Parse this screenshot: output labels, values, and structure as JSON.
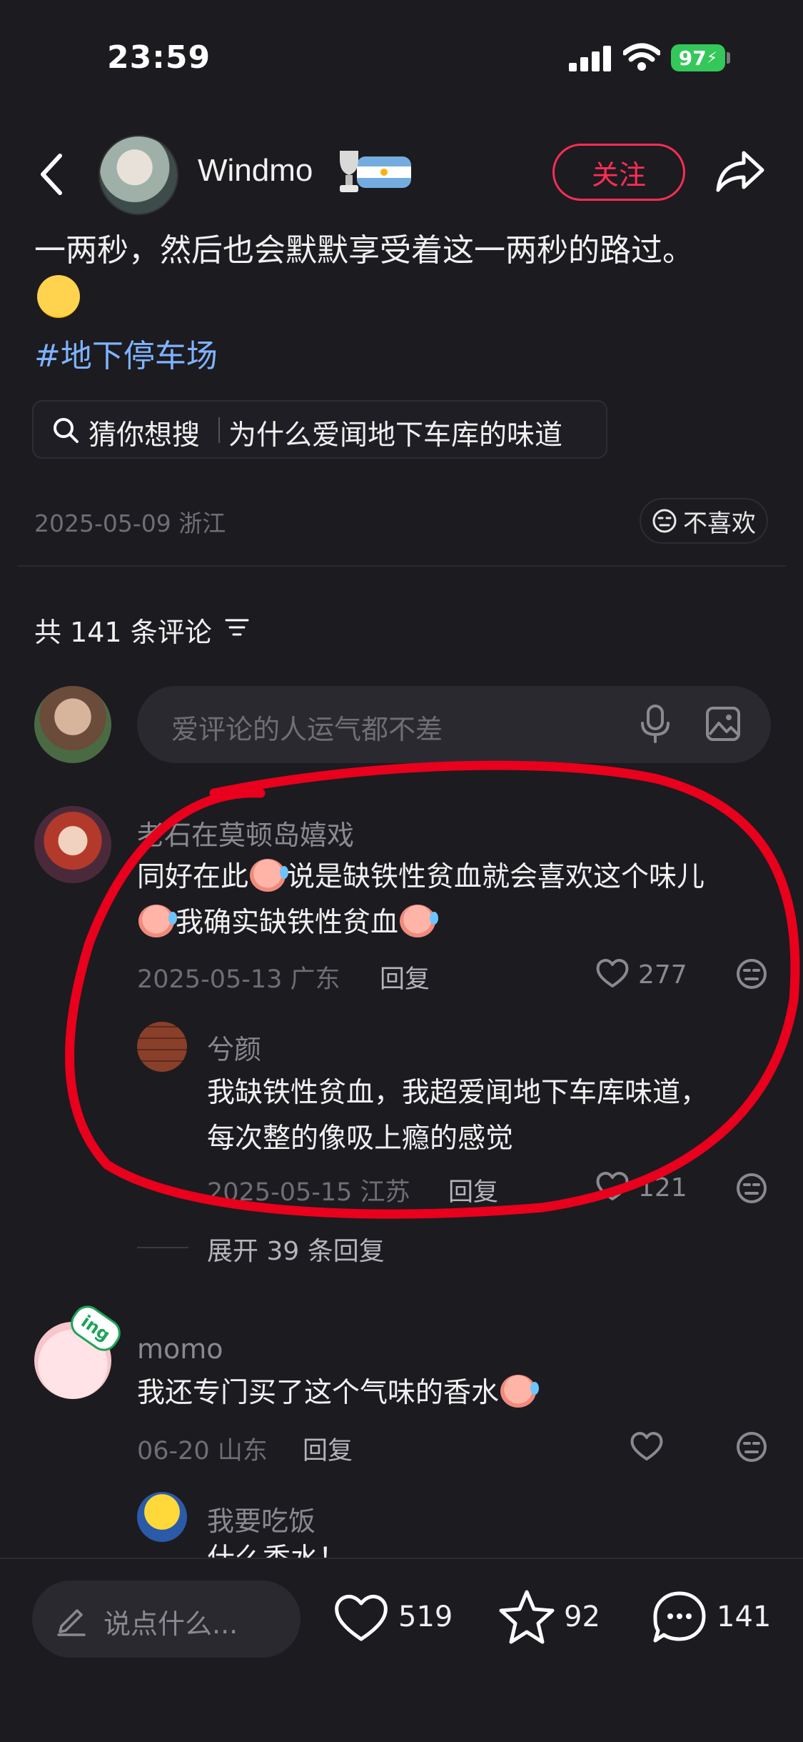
{
  "status_bar": {
    "time": "23:59",
    "battery": "97"
  },
  "header": {
    "author": "Windmo",
    "follow_label": "关注"
  },
  "post": {
    "text_line": "一两秒，然后也会默默享受着这一两秒的路过。",
    "hashtag": "#地下停车场",
    "search_tag": "猜你想搜",
    "search_query": "为什么爱闻地下车库的味道",
    "date_location": "2025-05-09 浙江",
    "dislike_label": "不喜欢"
  },
  "comments_header": {
    "count_label": "共 141 条评论"
  },
  "comment_input": {
    "placeholder": "爱评论的人运气都不差"
  },
  "comments": [
    {
      "user": "老石在莫顿岛嬉戏",
      "text_a": "同好在此",
      "text_b": "说是缺铁性贫血就会喜欢这个味儿",
      "text_c": "我确实缺铁性贫血",
      "date_location": "2025-05-13 广东",
      "reply_label": "回复",
      "likes": "277",
      "reply": {
        "user": "兮颜",
        "text_line1": "我缺铁性贫血，我超爱闻地下车库味道，",
        "text_line2": "每次整的像吸上瘾的感觉",
        "date_location": "2025-05-15 江苏",
        "reply_label": "回复",
        "likes": "121"
      },
      "expand_label": "展开 39 条回复"
    },
    {
      "user": "momo",
      "avatar_badge": "ing",
      "text": "我还专门买了这个气味的香水",
      "date_location": "06-20 山东",
      "reply_label": "回复",
      "reply": {
        "user": "我要吃饭",
        "text_partial": "什么香水！"
      }
    }
  ],
  "bottom_bar": {
    "say_placeholder": "说点什么...",
    "likes": "519",
    "favorites": "92",
    "comments": "141"
  },
  "colors": {
    "background": "#1c1b20",
    "accent": "#ff2d55",
    "hashtag": "#7fb3ff",
    "annotation": "#e8001c"
  }
}
